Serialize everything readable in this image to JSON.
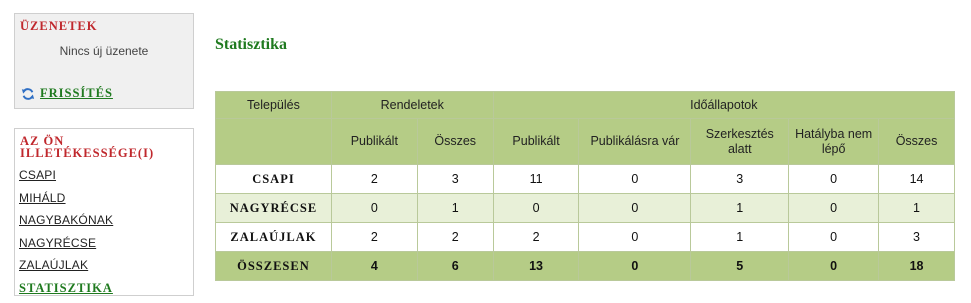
{
  "messages": {
    "title": "ÜZENETEK",
    "empty_text": "Nincs új üzenete",
    "refresh_label": "FRISSÍTÉS"
  },
  "jurisdiction": {
    "title": "AZ ÖN ILLETÉKESSÉGE(I)",
    "items": [
      "CSAPI",
      "MIHÁLD",
      "NAGYBAKÓNAK",
      "NAGYRÉCSE",
      "ZALAÚJLAK",
      "STATISZTIKA"
    ]
  },
  "page_title": "Statisztika",
  "table": {
    "group_headers": {
      "place": "Település",
      "decrees": "Rendeletek",
      "timestates": "Időállapotok"
    },
    "sub_headers": [
      "Publikált",
      "Összes",
      "Publikált",
      "Publikálásra vár",
      "Szerkesztés alatt",
      "Hatályba nem lépő",
      "Összes"
    ],
    "rows": [
      {
        "place": "CSAPI",
        "values": [
          "2",
          "3",
          "11",
          "0",
          "3",
          "0",
          "14"
        ]
      },
      {
        "place": "NAGYRÉCSE",
        "values": [
          "0",
          "1",
          "0",
          "0",
          "1",
          "0",
          "1"
        ]
      },
      {
        "place": "ZALAÚJLAK",
        "values": [
          "2",
          "2",
          "2",
          "0",
          "1",
          "0",
          "3"
        ]
      }
    ],
    "total": {
      "place": "ÖSSZESEN",
      "values": [
        "4",
        "6",
        "13",
        "0",
        "5",
        "0",
        "18"
      ]
    }
  }
}
